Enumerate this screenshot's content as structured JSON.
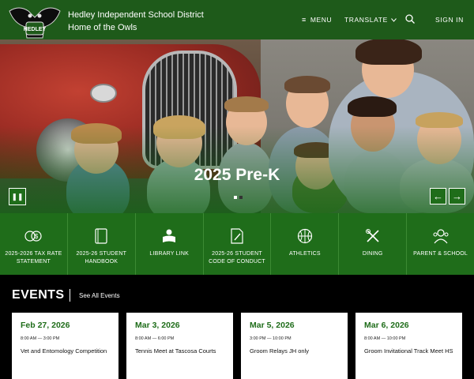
{
  "colors": {
    "brand_green": "#1f6d1a",
    "header_green": "#1e5a1a",
    "events_bg": "#000000",
    "card_bg": "#ffffff"
  },
  "header": {
    "logo_icon": "owl-logo-icon",
    "district_name": "Hedley Independent School District",
    "tagline": "Home of the Owls",
    "menu_label": "MENU",
    "translate_label": "TRANSLATE",
    "search_icon": "search-icon",
    "signin_label": "SIGN IN"
  },
  "hero": {
    "caption": "2025 Pre-K",
    "slide_count": 2,
    "active_slide": 1,
    "pause_icon": "pause-icon",
    "prev_icon": "arrow-left-icon",
    "next_icon": "arrow-right-icon"
  },
  "quick_links": [
    {
      "label": "2025-2026 TAX RATE STATEMENT",
      "icon": "coins-icon"
    },
    {
      "label": "2025-26 STUDENT HANDBOOK",
      "icon": "book-icon"
    },
    {
      "label": "LIBRARY LINK",
      "icon": "reader-icon"
    },
    {
      "label": "2025-26 STUDENT CODE OF CONDUCT",
      "icon": "document-pen-icon"
    },
    {
      "label": "ATHLETICS",
      "icon": "basketball-icon"
    },
    {
      "label": "DINING",
      "icon": "utensils-icon"
    },
    {
      "label": "PARENT & SCHOOL",
      "icon": "family-icon"
    }
  ],
  "events": {
    "title": "EVENTS",
    "see_all_label": "See All Events",
    "items": [
      {
        "date": "Feb 27, 2026",
        "time": "8:00 AM — 3:00 PM",
        "title": "Vet and Entomology Competition"
      },
      {
        "date": "Mar 3, 2026",
        "time": "8:00 AM — 6:00 PM",
        "title": "Tennis Meet at Tascosa Courts"
      },
      {
        "date": "Mar 5, 2026",
        "time": "3:00 PM — 10:00 PM",
        "title": "Groom Relays JH only"
      },
      {
        "date": "Mar 6, 2026",
        "time": "8:00 AM — 10:00 PM",
        "title": "Groom Invitational Track Meet HS"
      }
    ]
  }
}
